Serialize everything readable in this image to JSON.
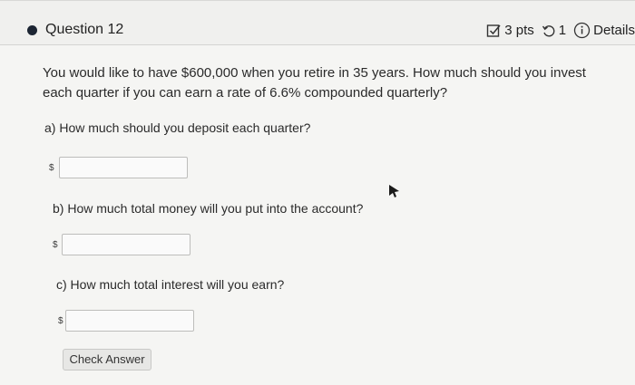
{
  "header": {
    "question_title": "Question 12",
    "points": "3 pts",
    "attempts": "1",
    "details_label": "Details"
  },
  "question": {
    "text": "You would like to have $600,000 when you retire in 35 years. How much should you invest each quarter if you can earn a rate of 6.6% compounded quarterly?"
  },
  "parts": [
    {
      "label": "a) How much should you deposit each quarter?",
      "currency": "$",
      "value": ""
    },
    {
      "label": "b) How much total money will you put into the account?",
      "currency": "$",
      "value": ""
    },
    {
      "label": "c) How much total interest will you earn?",
      "currency": "$",
      "value": ""
    }
  ],
  "actions": {
    "check_answer_label": "Check Answer"
  },
  "colors": {
    "bullet": "#1c2533",
    "background": "#f5f5f3",
    "input_border": "#bdbdbb"
  },
  "icons": [
    "bullet-dot-icon",
    "edit-checkbox-icon",
    "retry-icon",
    "info-circle-icon",
    "mouse-cursor-icon"
  ]
}
